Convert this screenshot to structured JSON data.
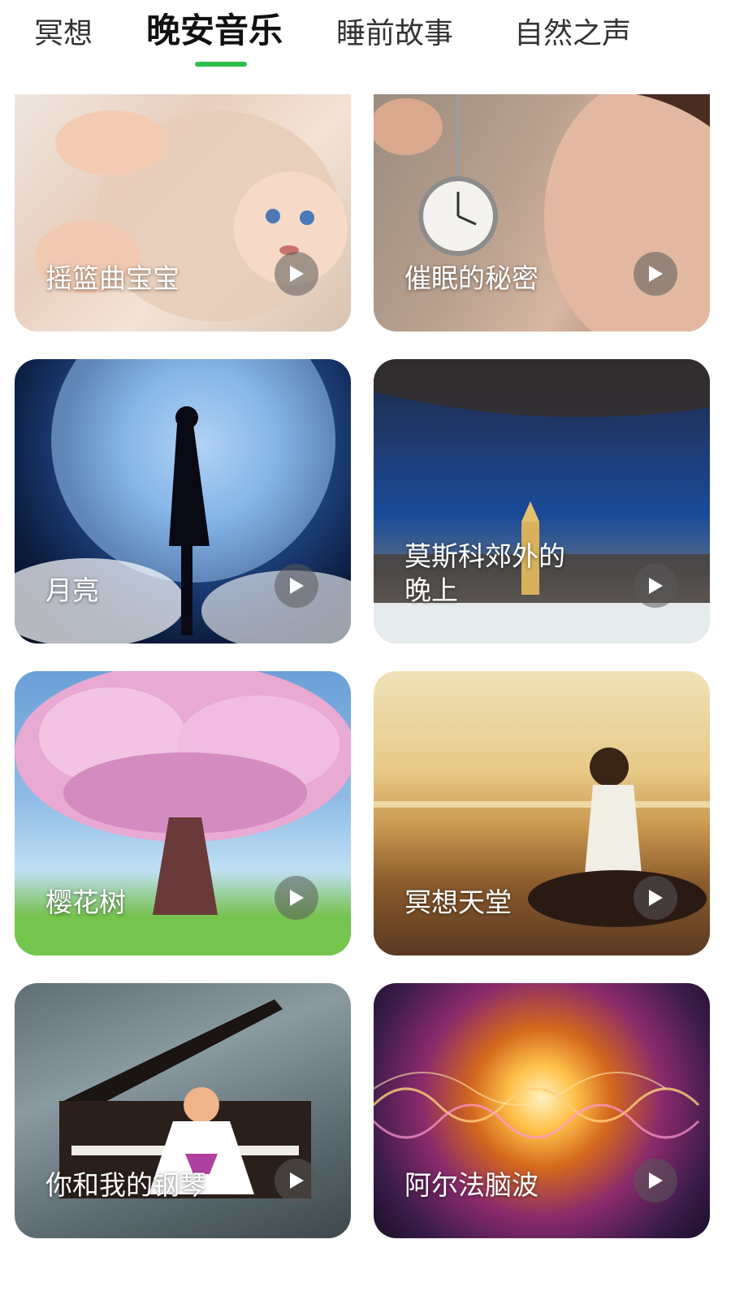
{
  "tabs": [
    {
      "label": "冥想",
      "active": false
    },
    {
      "label": "晚安音乐",
      "active": true
    },
    {
      "label": "睡前故事",
      "active": false
    },
    {
      "label": "自然之声",
      "active": false
    }
  ],
  "theme": {
    "accent": "#2dbf4a",
    "text_active": "#111111",
    "text_inactive": "#333333"
  },
  "cards": [
    {
      "title": "摇篮曲宝宝",
      "icon": "play-icon"
    },
    {
      "title": "催眠的秘密",
      "icon": "play-icon"
    },
    {
      "title": "月亮",
      "icon": "play-icon"
    },
    {
      "title": "莫斯科郊外的晚上",
      "icon": "play-icon"
    },
    {
      "title": "樱花树",
      "icon": "play-icon"
    },
    {
      "title": "冥想天堂",
      "icon": "play-icon"
    },
    {
      "title": "你和我的钢琴",
      "icon": "play-icon"
    },
    {
      "title": "阿尔法脑波",
      "icon": "play-icon"
    }
  ]
}
